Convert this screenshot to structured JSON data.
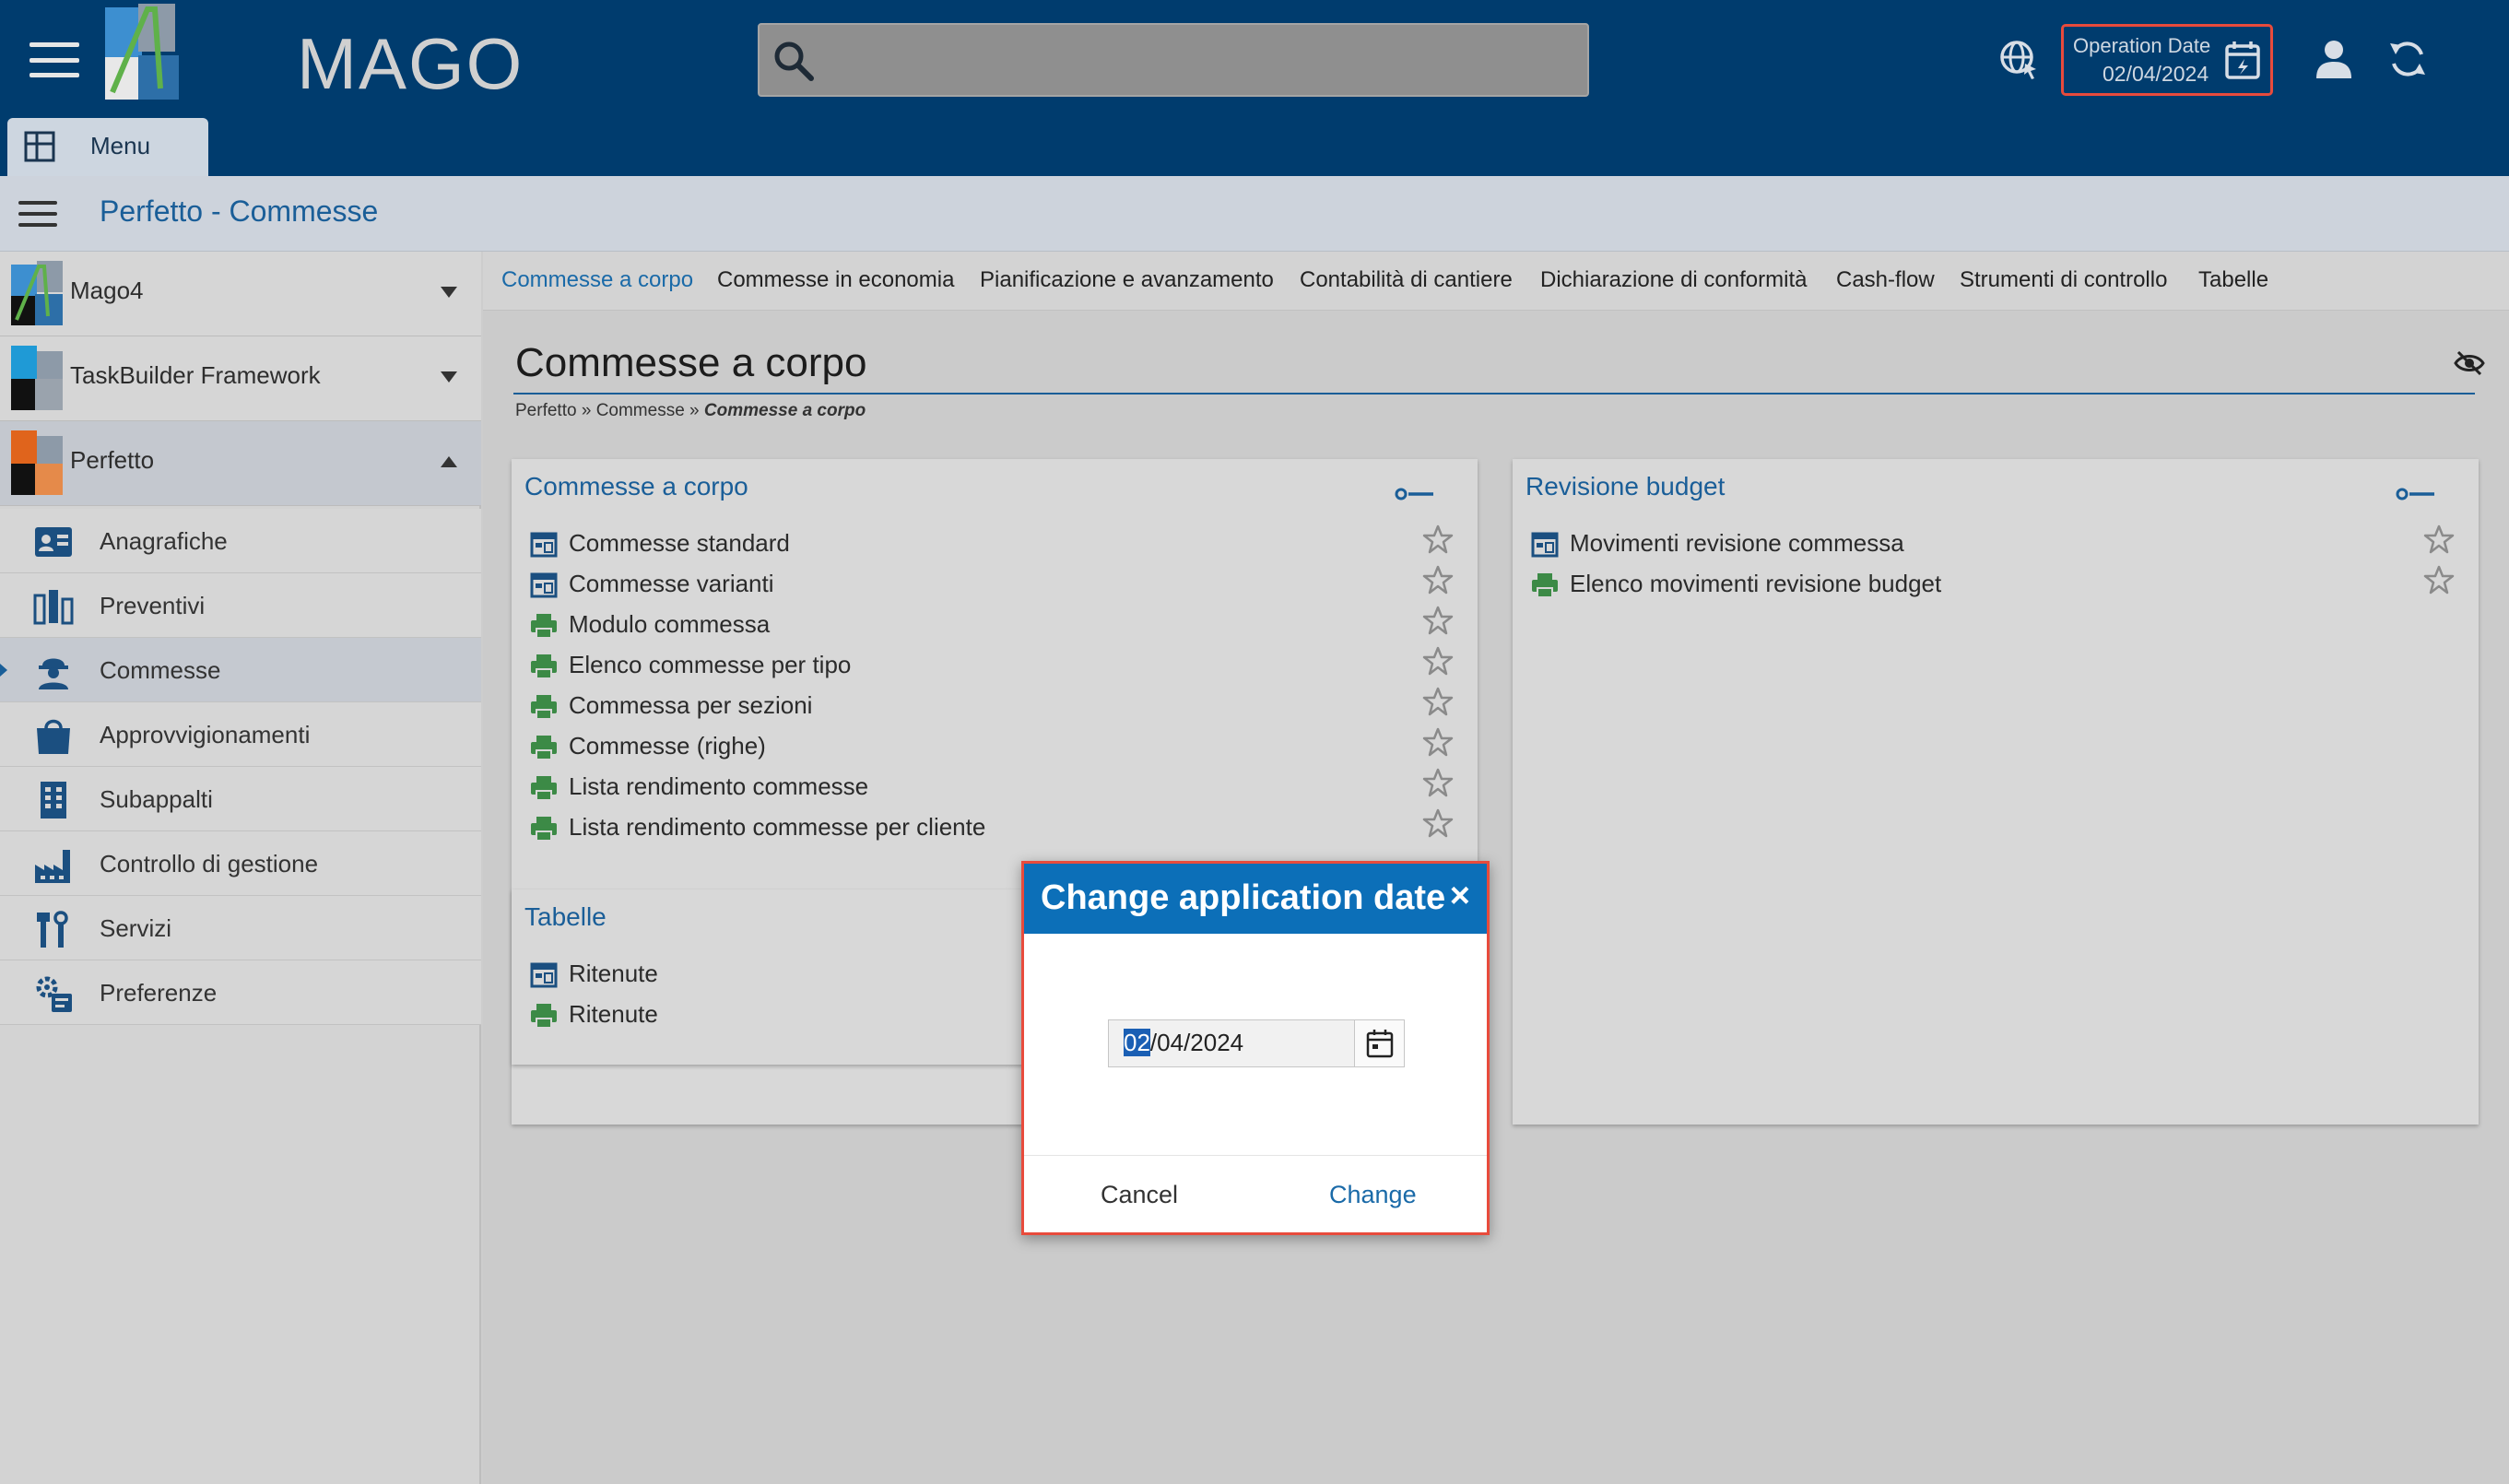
{
  "header": {
    "logo_text": "MAGO",
    "search_placeholder": "",
    "operation_date_label": "Operation Date",
    "operation_date_value": "02/04/2024"
  },
  "menu_tab": {
    "label": "Menu"
  },
  "title_bar": {
    "title": "Perfetto - Commesse"
  },
  "sidebar": {
    "groups": [
      {
        "label": "Mago4"
      },
      {
        "label": "TaskBuilder Framework"
      },
      {
        "label": "Perfetto"
      }
    ],
    "items": [
      {
        "label": "Anagrafiche"
      },
      {
        "label": "Preventivi"
      },
      {
        "label": "Commesse"
      },
      {
        "label": "Approvvigionamenti"
      },
      {
        "label": "Subappalti"
      },
      {
        "label": "Controllo di gestione"
      },
      {
        "label": "Servizi"
      },
      {
        "label": "Preferenze"
      }
    ]
  },
  "tabs": [
    {
      "label": "Commesse a corpo"
    },
    {
      "label": "Commesse in economia"
    },
    {
      "label": "Pianificazione e avanzamento"
    },
    {
      "label": "Contabilità di cantiere"
    },
    {
      "label": "Dichiarazione di conformità"
    },
    {
      "label": "Cash-flow"
    },
    {
      "label": "Strumenti di controllo"
    },
    {
      "label": "Tabelle"
    }
  ],
  "page": {
    "heading": "Commesse a corpo",
    "breadcrumb": {
      "a": "Perfetto",
      "sep": "»",
      "b": "Commesse",
      "c": "Commesse a corpo"
    }
  },
  "panels": {
    "commesse": {
      "title": "Commesse a corpo",
      "items": [
        {
          "label": "Commesse standard"
        },
        {
          "label": "Commesse varianti"
        },
        {
          "label": "Modulo commessa"
        },
        {
          "label": "Elenco commesse per tipo"
        },
        {
          "label": "Commessa per sezioni"
        },
        {
          "label": "Commesse (righe)"
        },
        {
          "label": "Lista rendimento commesse"
        },
        {
          "label": "Lista rendimento commesse per cliente"
        }
      ]
    },
    "revisione": {
      "title": "Revisione budget",
      "items": [
        {
          "label": "Movimenti revisione commessa"
        },
        {
          "label": "Elenco movimenti revisione budget"
        }
      ]
    },
    "tabelle": {
      "title": "Tabelle",
      "items": [
        {
          "label": "Ritenute"
        },
        {
          "label": "Ritenute"
        }
      ]
    }
  },
  "modal": {
    "title": "Change application date",
    "close": "×",
    "date_day": "02",
    "date_rest": "/04/2024",
    "cancel_label": "Cancel",
    "change_label": "Change"
  },
  "colors": {
    "header_bg": "#003c6e",
    "accent": "#1a5e98",
    "modal_header": "#0c6fb8",
    "highlight_border": "#e84b3c",
    "report_icon": "#3c8a46"
  }
}
